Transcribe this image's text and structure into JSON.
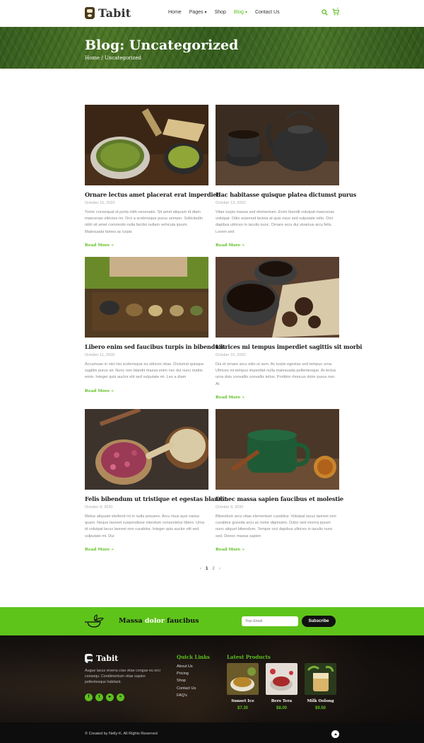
{
  "header": {
    "brand": "Tabit",
    "nav": [
      {
        "label": "Home",
        "has_caret": false,
        "active": false
      },
      {
        "label": "Pages",
        "has_caret": true,
        "active": false
      },
      {
        "label": "Shop",
        "has_caret": false,
        "active": false
      },
      {
        "label": "Blog",
        "has_caret": true,
        "active": true
      },
      {
        "label": "Contact Us",
        "has_caret": false,
        "active": false
      }
    ],
    "cart_count": "0",
    "icons": [
      "search-icon",
      "cart-icon"
    ]
  },
  "hero": {
    "title": "Blog: Uncategorized",
    "breadcrumb": "Home / Uncategorized"
  },
  "posts": [
    {
      "title": "Ornare lectus amet placerat erat imperdiet",
      "date": "October 15, 2020",
      "excerpt": "Tortor consequat id porta nibh venenatis. Sit amet aliquam id diam maecenas ultricies mi. Orci a scelerisque purus semper. Sollicitudin nibh sit amet commodo nulla facilisi nullam vehicula ipsum. Malesuada fames ac turpis",
      "read_more": "Read More »"
    },
    {
      "title": "Hac habitasse quisque platea dictumst purus",
      "date": "October 13, 2020",
      "excerpt": "Vitae turpis massa sed elementum. Enim blandit volutpat maecenas volutpat. Odio euismod lacinia at quis risus sed vulputate odio. Orci dapibus ultrices in iaculis nunc. Ornare arcu dui vivamus arcu felis. Lorem sed",
      "read_more": "Read More »"
    },
    {
      "title": "Libero enim sed faucibus turpis in bibendum",
      "date": "October 11, 2020",
      "excerpt": "Accumsan in nisl nisi scelerisque eu ultrices vitae. Dictumst quisque sagittis purus sit. Nunc non blandit massa enim nec dui nunc mattis enim. Integer quis auctor elit sed vulputate mi. Leo a diam",
      "read_more": "Read More »"
    },
    {
      "title": "Ultrices mi tempus imperdiet sagittis sit morbi",
      "date": "October 10, 2020",
      "excerpt": "Dui id ornare arcu odio ut sem. Ac turpis egestas sed tempus urna. Ultrices mi tempus imperdiet nulla malesuada pellentesque. At lectus urna duis convallis convallis tellus. Porttitor rhoncus dolor purus non. At",
      "read_more": "Read More »"
    },
    {
      "title": "Felis bibendum ut tristique et egestas blandit",
      "date": "October 9, 2020",
      "excerpt": "Metus aliquam eleifend mi in nulla posuere. Arcu risus quis varius quam. Neque laoreet suspendisse interdum consectetur libero. Urna id volutpat lacus laoreet non curabitur. Integer quis auctor elit sed vulputate mi. Dui",
      "read_more": "Read More »"
    },
    {
      "title": "Donec massa sapien faucibus et molestie",
      "date": "October 9, 2020",
      "excerpt": "Bibendum arcu vitae elementum curabitur. Volutpat lacus laoreet non curabitur gravida arcu ac tortor dignissim. Dolor sed viverra ipsum nunc aliquet bibendum. Tempor orci dapibus ultrices in iaculis nunc sed. Donec massa sapien",
      "read_more": "Read More »"
    }
  ],
  "pagination": {
    "prev": "‹",
    "current": "1",
    "next_page": "2",
    "next": "›"
  },
  "newsletter": {
    "text_before": "Massa ",
    "text_highlight": "dolor",
    "text_after": " faucibus",
    "placeholder": "Your Email",
    "button": "Subscribe"
  },
  "footer": {
    "brand": "Tabit",
    "about": "Augue lacus viverra cras vitae congue eu orci consequ. Condimentum vitae sapien pellentesque habitant.",
    "socials": [
      "facebook-icon",
      "twitter-icon",
      "youtube-icon",
      "spotify-icon"
    ],
    "quick_links_heading": "Quick Links",
    "quick_links": [
      "About Us",
      "Pricing",
      "Shop",
      "Contact Us",
      "FAQ's"
    ],
    "products_heading": "Latest Products",
    "products": [
      {
        "name": "Sunset Ice",
        "price": "$7.30"
      },
      {
        "name": "Bers Tera",
        "price": "$8.00"
      },
      {
        "name": "Milk Oolong",
        "price": "$9.50"
      }
    ],
    "copyright": "© Created by Nelly-K. All Rights Reserved"
  },
  "colors": {
    "accent": "#5dbf1f",
    "newsletter_bg": "#5fc41a",
    "footer_bg": "#161210"
  }
}
